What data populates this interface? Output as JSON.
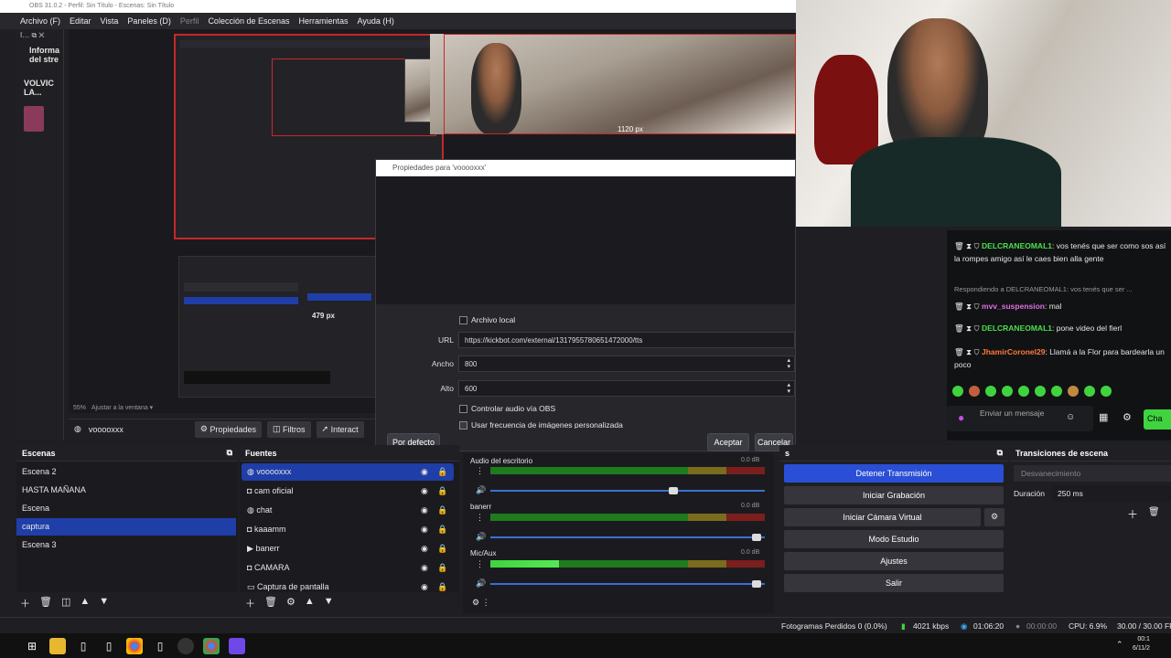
{
  "window": {
    "title": "OBS 31.0.2 - Perfil: Sin Título - Escenas: Sin Título"
  },
  "menu": [
    "Archivo (F)",
    "Editar",
    "Vista",
    "Paneles (D)",
    "Perfil",
    "Colección de Escenas",
    "Herramientas",
    "Ayuda (H)"
  ],
  "left_dock": {
    "title": "Informa del stre",
    "channel": "VOLVIC LA..."
  },
  "dialog": {
    "title": "Propiedades para 'vooooxxx'",
    "local_file_label": "Archivo local",
    "url_label": "URL",
    "url_value": "https://kickbot.com/external/1317955780651472000/tts",
    "width_label": "Ancho",
    "width_value": "800",
    "height_label": "Alto",
    "height_value": "600",
    "audio_label": "Controlar audio vía OBS",
    "fps_label": "Usar frecuencia de imágenes personalizada",
    "defaults": "Por defecto",
    "accept": "Aceptar",
    "cancel": "Cancelar"
  },
  "canvas": {
    "zoom": "55%",
    "fit": "Ajustar a la ventana",
    "size_badge": "1120 px",
    "size_badge_small": "479 px"
  },
  "source_bar": {
    "name": "vooooxxx",
    "properties": "Propiedades",
    "filters": "Filtros",
    "interact": "Interact"
  },
  "scenes": {
    "title": "Escenas",
    "items": [
      "Escena 2",
      "HASTA MAÑANA",
      "Escena",
      "captura",
      "Escena 3"
    ],
    "selected": 3
  },
  "sources": {
    "title": "Fuentes",
    "items": [
      {
        "name": "vooooxxx",
        "icon": "globe-icon"
      },
      {
        "name": "cam oficial",
        "icon": "camera-icon"
      },
      {
        "name": "chat",
        "icon": "globe-icon"
      },
      {
        "name": "kaaamm",
        "icon": "camera-icon"
      },
      {
        "name": "banerr",
        "icon": "play-icon"
      },
      {
        "name": "CAMARA",
        "icon": "camera-icon"
      },
      {
        "name": "Captura de pantalla",
        "icon": "monitor-icon"
      }
    ]
  },
  "mixer": {
    "channels": [
      {
        "name": "Audio del escritorio",
        "db": "0.0 dB",
        "level": 0
      },
      {
        "name": "banerr",
        "db": "0.0 dB",
        "level": 0
      },
      {
        "name": "Mic/Aux",
        "db": "0.0 dB",
        "level": 0.25
      }
    ],
    "ticks": [
      "-60",
      "-55",
      "-50",
      "-45",
      "-40",
      "-35",
      "-30",
      "-25",
      "-20",
      "-15",
      "-10",
      "-5",
      "0"
    ]
  },
  "controls": {
    "title": "s",
    "buttons": [
      "Detener Transmisión",
      "Iniciar Grabación",
      "Iniciar Cámara Virtual",
      "Modo Estudio",
      "Ajustes",
      "Salir"
    ]
  },
  "transitions": {
    "title": "Transiciones de escena",
    "type": "Desvanecimiento",
    "duration_label": "Duración",
    "duration_value": "250 ms"
  },
  "chat": {
    "messages": [
      {
        "user": "DELCRANEOMAL1",
        "text": ": vos tenés que ser como sos así la rompes amigo así le caes bien alla gente",
        "color": "#4be04b"
      },
      {
        "reply": "Respondiendo a DELCRANEOMAL1: vos tenés que ser ..."
      },
      {
        "user": "mvv_suspension",
        "text": ": mal",
        "color": "#e070e0"
      },
      {
        "user": "DELCRANEOMAL1",
        "text": ": pone video del fierl",
        "color": "#4be04b"
      },
      {
        "user": "JhamirCoronel29",
        "text": ": Llamá a la Flor para bardearla un poco",
        "color": "#ff7b3b"
      }
    ],
    "input_placeholder": "Enviar un mensaje",
    "send": "Cha"
  },
  "status": {
    "dropped": "Fotogramas Perdidos 0 (0.0%)",
    "kbps": "4021 kbps",
    "live_time": "01:06:20",
    "rec_time": "00:00:00",
    "cpu": "CPU: 6.9%",
    "fps": "30.00 / 30.00 FP"
  },
  "clock": {
    "time": "00:1",
    "date": "6/11/2"
  }
}
